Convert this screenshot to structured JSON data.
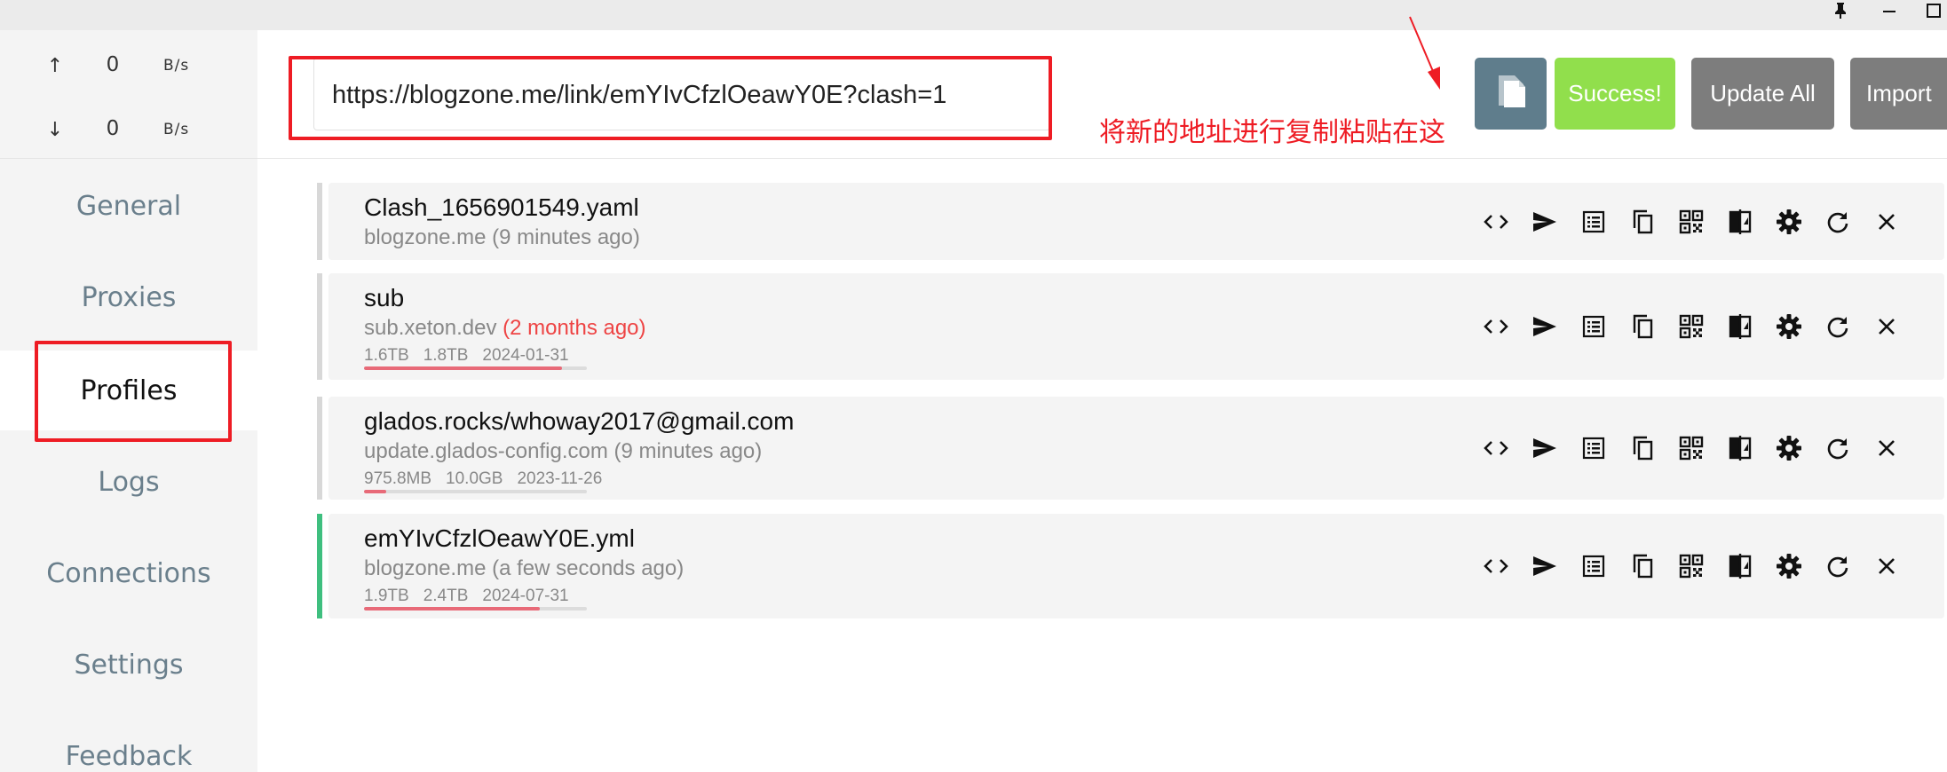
{
  "window": {
    "controls": [
      "pin-icon",
      "minimize-icon",
      "maximize-icon"
    ]
  },
  "traffic": {
    "upload": {
      "arrow": "↑",
      "value": "0",
      "unit": "B/s"
    },
    "download": {
      "arrow": "↓",
      "value": "0",
      "unit": "B/s"
    }
  },
  "sidebar": {
    "items": [
      {
        "label": "General"
      },
      {
        "label": "Proxies"
      },
      {
        "label": "Profiles"
      },
      {
        "label": "Logs"
      },
      {
        "label": "Connections"
      },
      {
        "label": "Settings"
      },
      {
        "label": "Feedback"
      }
    ],
    "active": "Profiles"
  },
  "toolbar": {
    "url_value": "https://blogzone.me/link/emYIvCfzlOeawY0E?clash=1",
    "paste_icon": "clipboard-icon",
    "success_label": "Success!",
    "update_all_label": "Update All",
    "import_label": "Import"
  },
  "annotation": {
    "text": "将新的地址进行复制粘贴在这",
    "color": "#ee1c24"
  },
  "profiles": [
    {
      "name": "Clash_1656901549.yaml",
      "host": "blogzone.me",
      "ago": "(9 minutes ago)",
      "ago_stale": false
    },
    {
      "name": "sub",
      "host": "sub.xeton.dev",
      "ago": "(2 months ago)",
      "ago_stale": true,
      "used": "1.6TB",
      "total": "1.8TB",
      "expire": "2024-01-31",
      "usage_fraction": 0.89
    },
    {
      "name": "glados.rocks/whoway2017@gmail.com",
      "host": "update.glados-config.com",
      "ago": "(9 minutes ago)",
      "ago_stale": false,
      "used": "975.8MB",
      "total": "10.0GB",
      "expire": "2023-11-26",
      "usage_fraction": 0.1
    },
    {
      "name": "emYIvCfzlOeawY0E.yml",
      "host": "blogzone.me",
      "ago": "(a few seconds ago)",
      "ago_stale": false,
      "used": "1.9TB",
      "total": "2.4TB",
      "expire": "2024-07-31",
      "usage_fraction": 0.79,
      "current": true
    }
  ],
  "profile_actions": [
    "code-icon",
    "send-icon",
    "list-icon",
    "copy-icon",
    "qrcode-icon",
    "compare-icon",
    "gear-icon",
    "refresh-icon",
    "close-icon"
  ],
  "colors": {
    "success": "#91df4c",
    "neutral_button": "#7d7d7d",
    "paste_button": "#5f7d8c",
    "current_profile": "#3fbf7f",
    "usage_bar": "#e86a78",
    "annotation": "#ee1c24"
  }
}
